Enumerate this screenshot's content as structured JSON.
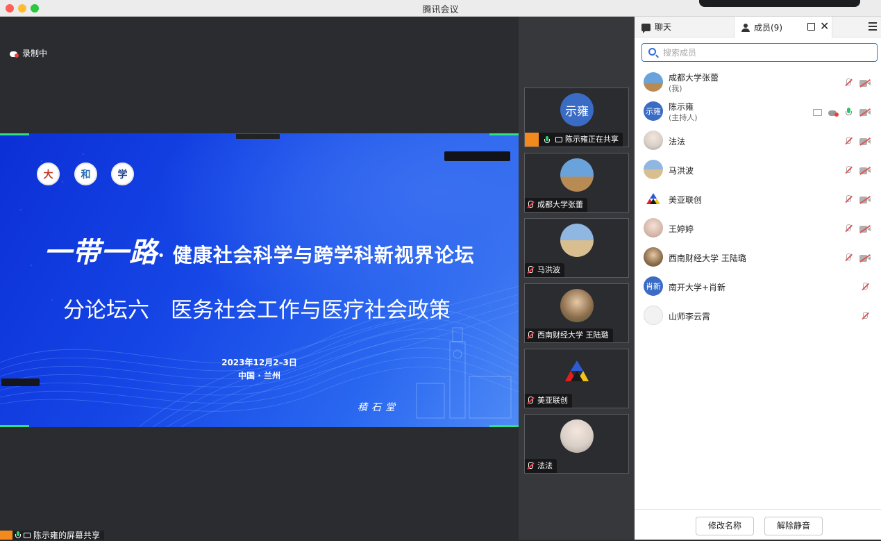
{
  "window": {
    "title": "腾讯会议"
  },
  "recording": {
    "label": "录制中"
  },
  "slide": {
    "title_prefix": "一带一路",
    "title_rest": "· 健康社会科学与跨学科新视界论坛",
    "subtitle": "分论坛六　医务社会工作与医疗社会政策",
    "date": "2023年12月2–3日",
    "place": "中国 · 兰州",
    "signature": "積石堂",
    "logos": [
      "大",
      "和",
      "学"
    ]
  },
  "share_bar": {
    "label": "陈示雍的屏幕共享"
  },
  "gallery": [
    {
      "name": "陈示雍正在共享",
      "avatar_text": "示雍",
      "sharing": true
    },
    {
      "name": "成都大学张蕾",
      "avatar_color": "#5b8fc7"
    },
    {
      "name": "马洪波",
      "avatar_color": "#e0c9a4"
    },
    {
      "name": "西南财经大学 王陆璐",
      "avatar_color": "#8a6b4a"
    },
    {
      "name": "美亚联创",
      "avatar_color": "#2b2c30"
    },
    {
      "name": "法法",
      "avatar_color": "#d9d0c8"
    }
  ],
  "panel": {
    "tab_chat": "聊天",
    "tab_members": "成员(9)",
    "search_placeholder": "搜索成员",
    "members": [
      {
        "name": "成都大学张蕾",
        "sub": "(我)"
      },
      {
        "name": "陈示雍",
        "sub": "(主持人)",
        "avatar_text": "示雍"
      },
      {
        "name": "法法"
      },
      {
        "name": "马洪波"
      },
      {
        "name": "美亚联创"
      },
      {
        "name": "王婷婷"
      },
      {
        "name": "西南财经大学 王陆璐"
      },
      {
        "name": "南开大学+肖新",
        "avatar_text": "肖新"
      },
      {
        "name": "山师李云霄"
      }
    ],
    "btn_rename": "修改名称",
    "btn_unmute": "解除静音"
  }
}
